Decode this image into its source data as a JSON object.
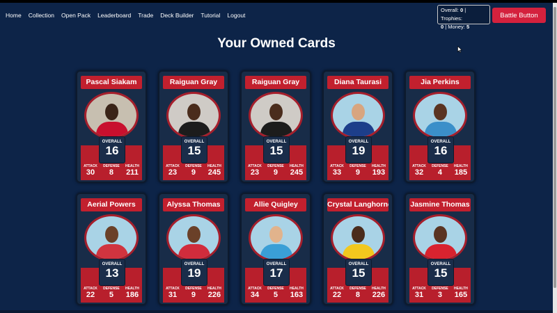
{
  "nav": [
    "Home",
    "Collection",
    "Open Pack",
    "Leaderboard",
    "Trade",
    "Deck Builder",
    "Tutorial",
    "Logout"
  ],
  "stats": {
    "overall_label": "Overall:",
    "overall": "0",
    "trophies_label": "| Trophies:",
    "trophies": "0",
    "money_label": "| Money:",
    "money": "5"
  },
  "battle_button": "Battle Button",
  "title": "Your Owned Cards",
  "stat_labels": {
    "overall": "OVERALL",
    "attack": "ATTACK",
    "defense": "DEFENSE",
    "health": "HEALTH"
  },
  "cards": [
    {
      "name": "Pascal Siakam",
      "overall": "16",
      "attack": "30",
      "defense": "8",
      "health": "211",
      "bg": "#c7bfb0",
      "skin": "#3a2418",
      "jersey": "#c8102e"
    },
    {
      "name": "Raiguan Gray",
      "overall": "15",
      "attack": "23",
      "defense": "9",
      "health": "245",
      "bg": "#cfcbc6",
      "skin": "#4a2c1c",
      "jersey": "#1c1c1c"
    },
    {
      "name": "Raiguan Gray",
      "overall": "15",
      "attack": "23",
      "defense": "9",
      "health": "245",
      "bg": "#cfcbc6",
      "skin": "#4a2c1c",
      "jersey": "#1c1c1c"
    },
    {
      "name": "Diana Taurasi",
      "overall": "19",
      "attack": "33",
      "defense": "9",
      "health": "193",
      "bg": "#a9d3e6",
      "skin": "#d8a57f",
      "jersey": "#1d3e8a"
    },
    {
      "name": "Jia Perkins",
      "overall": "16",
      "attack": "32",
      "defense": "4",
      "health": "185",
      "bg": "#a9d3e6",
      "skin": "#5a3422",
      "jersey": "#3b8fc9"
    },
    {
      "name": "Aerial Powers",
      "overall": "13",
      "attack": "22",
      "defense": "5",
      "health": "186",
      "bg": "#a9d3e6",
      "skin": "#6a4028",
      "jersey": "#d0343f"
    },
    {
      "name": "Alyssa Thomas",
      "overall": "19",
      "attack": "31",
      "defense": "9",
      "health": "226",
      "bg": "#a9d3e6",
      "skin": "#6a4028",
      "jersey": "#d12c3c"
    },
    {
      "name": "Allie Quigley",
      "overall": "17",
      "attack": "34",
      "defense": "5",
      "health": "163",
      "bg": "#a9d3e6",
      "skin": "#e1b38c",
      "jersey": "#3a9fd6"
    },
    {
      "name": "Crystal Langhorne",
      "overall": "15",
      "attack": "22",
      "defense": "8",
      "health": "226",
      "bg": "#a9d3e6",
      "skin": "#4a2c1c",
      "jersey": "#f2c81e"
    },
    {
      "name": "Jasmine Thomas",
      "overall": "15",
      "attack": "31",
      "defense": "3",
      "health": "165",
      "bg": "#a9d3e6",
      "skin": "#5a3422",
      "jersey": "#d8232f"
    }
  ]
}
